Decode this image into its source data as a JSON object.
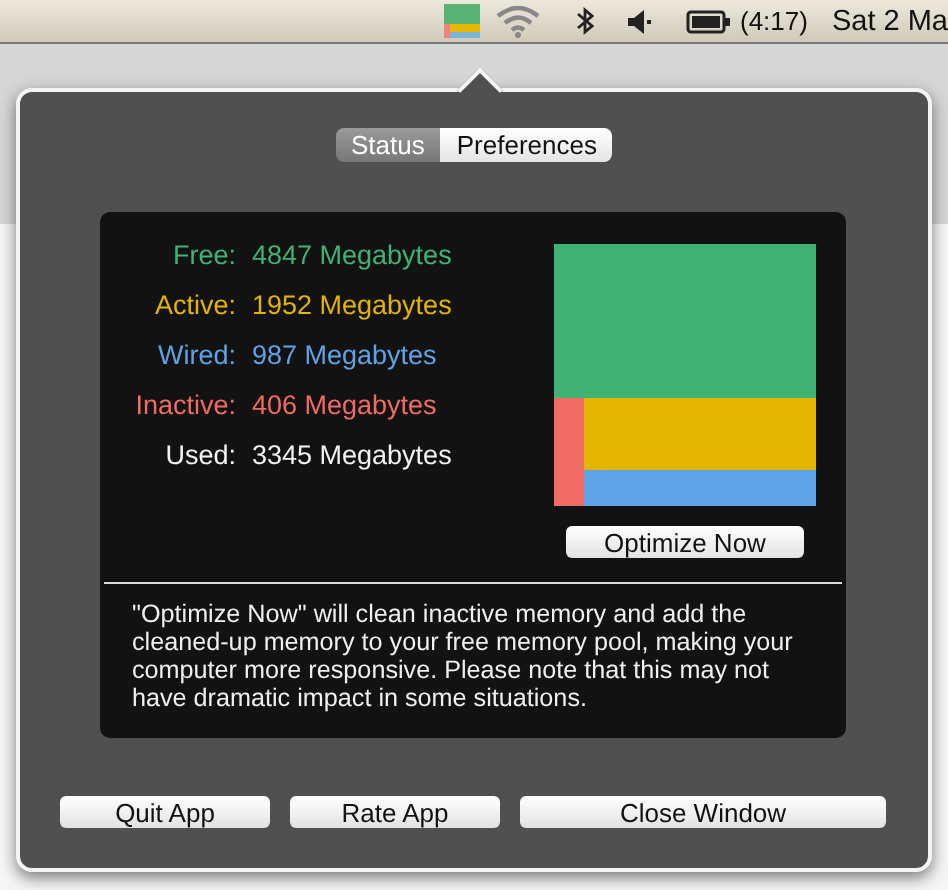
{
  "menubar": {
    "battery_time": "(4:17)",
    "clock": "Sat 2 Ma"
  },
  "popup": {
    "tabs": [
      {
        "label": "Status",
        "selected": true
      },
      {
        "label": "Preferences",
        "selected": false
      }
    ],
    "stats": [
      {
        "label": "Free:",
        "value": "4847 Megabytes",
        "color": "#3fb274"
      },
      {
        "label": "Active:",
        "value": "1952 Megabytes",
        "color": "#e3b400"
      },
      {
        "label": "Wired:",
        "value": "987 Megabytes",
        "color": "#5fa3e6"
      },
      {
        "label": "Inactive:",
        "value": "406 Megabytes",
        "color": "#f06b64"
      },
      {
        "label": "Used:",
        "value": "3345 Megabytes",
        "color": "#f2f2f2"
      }
    ],
    "optimize_button": "Optimize Now",
    "note": "\"Optimize Now\" will clean inactive memory and add the cleaned-up memory to your free memory pool, making your computer more responsive. Please note that this may not have dramatic impact in some situations.",
    "buttons": [
      "Quit App",
      "Rate App",
      "Close Window"
    ]
  }
}
